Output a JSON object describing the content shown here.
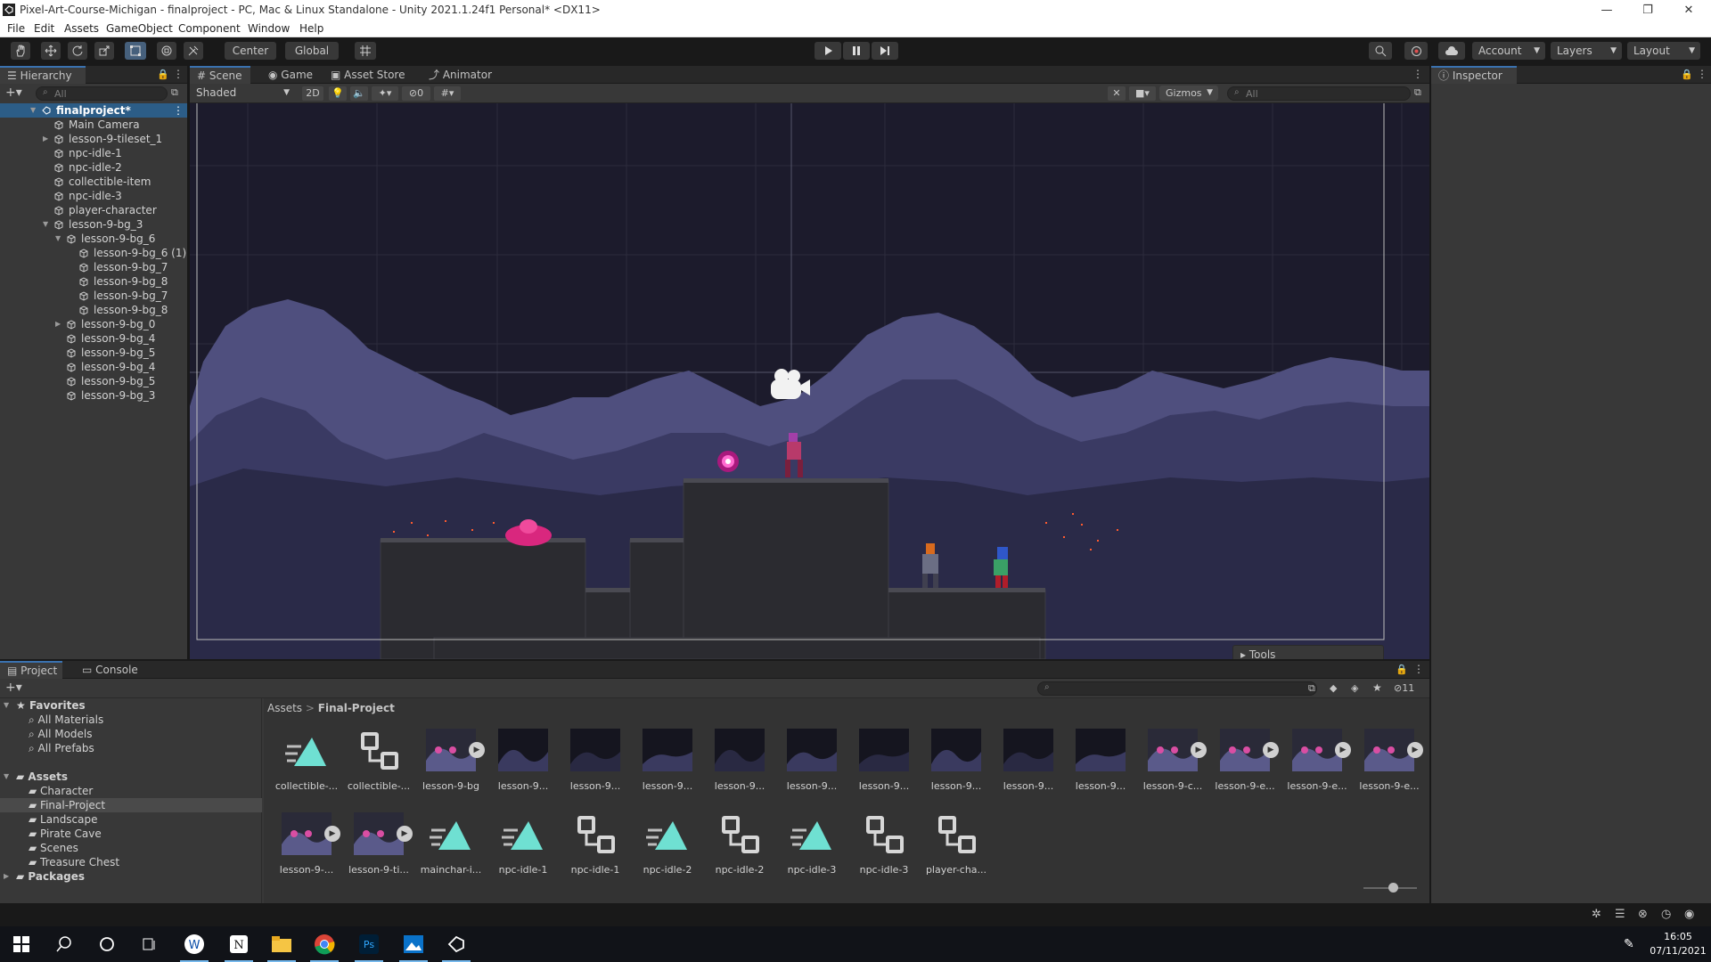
{
  "window": {
    "title": "Pixel-Art-Course-Michigan - finalproject - PC, Mac & Linux Standalone - Unity 2021.1.24f1 Personal* <DX11>",
    "minimize": "—",
    "restore": "❐",
    "close": "✕"
  },
  "menu": [
    "File",
    "Edit",
    "Assets",
    "GameObject",
    "Component",
    "Window",
    "Help"
  ],
  "toolbar": {
    "pivot": "Center",
    "space": "Global",
    "account": "Account",
    "layers": "Layers",
    "layout": "Layout"
  },
  "hierarchy": {
    "tab": "Hierarchy",
    "search_placeholder": "All",
    "root": "finalproject*",
    "items": [
      {
        "label": "Main Camera"
      },
      {
        "label": "lesson-9-tileset_1"
      },
      {
        "label": "npc-idle-1"
      },
      {
        "label": "npc-idle-2"
      },
      {
        "label": "collectible-item"
      },
      {
        "label": "npc-idle-3"
      },
      {
        "label": "player-character"
      },
      {
        "label": "lesson-9-bg_3"
      },
      {
        "label": "lesson-9-bg_6"
      },
      {
        "label": "lesson-9-bg_6 (1)"
      },
      {
        "label": "lesson-9-bg_7"
      },
      {
        "label": "lesson-9-bg_8"
      },
      {
        "label": "lesson-9-bg_7"
      },
      {
        "label": "lesson-9-bg_8"
      },
      {
        "label": "lesson-9-bg_0"
      },
      {
        "label": "lesson-9-bg_4"
      },
      {
        "label": "lesson-9-bg_5"
      },
      {
        "label": "lesson-9-bg_4"
      },
      {
        "label": "lesson-9-bg_5"
      },
      {
        "label": "lesson-9-bg_3"
      }
    ]
  },
  "scene": {
    "tabs": [
      "Scene",
      "Game",
      "Asset Store",
      "Animator"
    ],
    "shading": "Shaded",
    "mode_2d": "2D",
    "hidden_count": "0",
    "gizmos": "Gizmos",
    "search_placeholder": "All",
    "tools_overlay": "Tools"
  },
  "inspector": {
    "tab": "Inspector"
  },
  "project": {
    "tabs": [
      "Project",
      "Console"
    ],
    "favorites": {
      "label": "Favorites",
      "items": [
        "All Materials",
        "All Models",
        "All Prefabs"
      ]
    },
    "assets": {
      "label": "Assets",
      "items": [
        "Character",
        "Final-Project",
        "Landscape",
        "Pirate Cave",
        "Scenes",
        "Treasure Chest"
      ]
    },
    "packages": "Packages",
    "breadcrumb": [
      "Assets",
      "Final-Project"
    ],
    "hidden_count": "11",
    "grid_row1": [
      {
        "label": "collectible-...",
        "kind": "anim"
      },
      {
        "label": "collectible-...",
        "kind": "controller"
      },
      {
        "label": "lesson-9-bg",
        "kind": "sheet"
      },
      {
        "label": "lesson-9...",
        "kind": "sprite"
      },
      {
        "label": "lesson-9...",
        "kind": "sprite"
      },
      {
        "label": "lesson-9...",
        "kind": "sprite"
      },
      {
        "label": "lesson-9...",
        "kind": "sprite"
      },
      {
        "label": "lesson-9...",
        "kind": "sprite"
      },
      {
        "label": "lesson-9...",
        "kind": "sprite"
      },
      {
        "label": "lesson-9...",
        "kind": "sprite"
      },
      {
        "label": "lesson-9...",
        "kind": "sprite"
      },
      {
        "label": "lesson-9...",
        "kind": "sprite"
      },
      {
        "label": "lesson-9-c...",
        "kind": "sheet"
      },
      {
        "label": "lesson-9-e...",
        "kind": "sheet"
      },
      {
        "label": "lesson-9-e...",
        "kind": "sheet"
      },
      {
        "label": "lesson-9-e...",
        "kind": "sheet"
      }
    ],
    "grid_row2": [
      {
        "label": "lesson-9-...",
        "kind": "sheet"
      },
      {
        "label": "lesson-9-ti...",
        "kind": "sheet"
      },
      {
        "label": "mainchar-i...",
        "kind": "anim"
      },
      {
        "label": "npc-idle-1",
        "kind": "anim"
      },
      {
        "label": "npc-idle-1",
        "kind": "controller"
      },
      {
        "label": "npc-idle-2",
        "kind": "anim"
      },
      {
        "label": "npc-idle-2",
        "kind": "controller"
      },
      {
        "label": "npc-idle-3",
        "kind": "anim"
      },
      {
        "label": "npc-idle-3",
        "kind": "controller"
      },
      {
        "label": "player-cha...",
        "kind": "controller"
      }
    ]
  },
  "taskbar": {
    "time": "16:05",
    "date": "07/11/2021"
  },
  "colors": {
    "accent": "#3a72b0",
    "anim_icon": "#6fe0d2",
    "scene_bg": "#1c1b2c"
  }
}
